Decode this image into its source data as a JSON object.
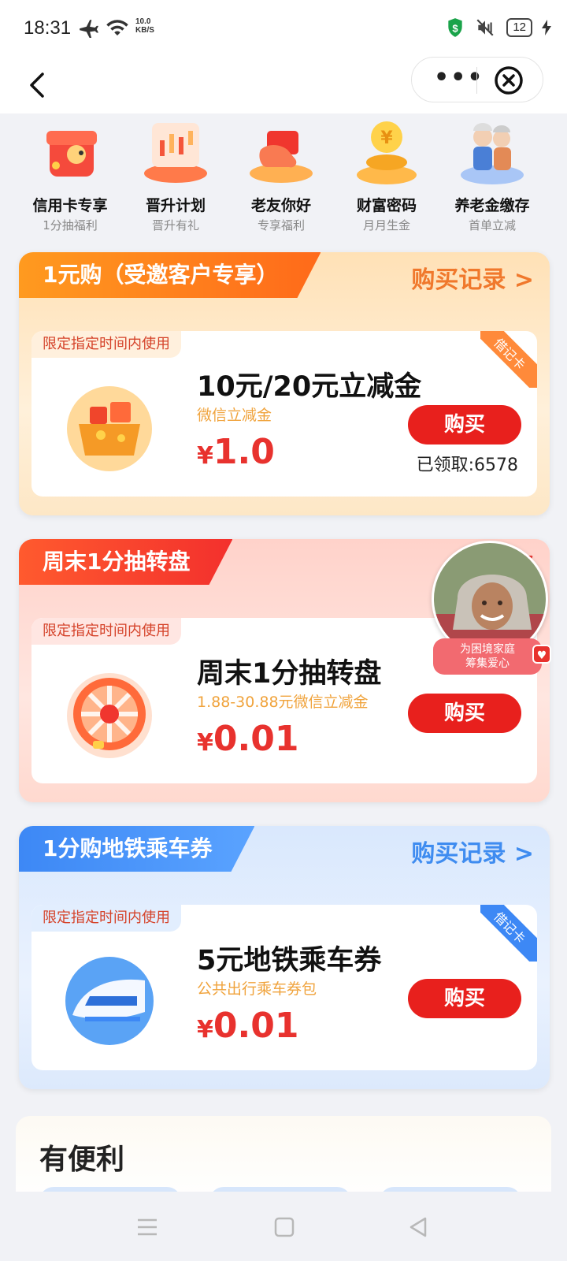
{
  "status_bar": {
    "time": "18:31",
    "net_speed_value": "10.0",
    "net_speed_unit": "KB/S",
    "battery": "12"
  },
  "nav": {
    "more_label": "•••"
  },
  "categories": [
    {
      "label": "信用卡专享",
      "sub": "1分抽福利"
    },
    {
      "label": "晋升计划",
      "sub": "晋升有礼"
    },
    {
      "label": "老友你好",
      "sub": "专享福利"
    },
    {
      "label": "财富密码",
      "sub": "月月生金"
    },
    {
      "label": "养老金缴存",
      "sub": "首单立减"
    }
  ],
  "cards": [
    {
      "tag": "1元购（受邀客户专享）",
      "link": "购买记录 >",
      "limit": "限定指定时间内使用",
      "corner": "借记卡",
      "title": "10元/20元立减金",
      "subtitle": "微信立减金",
      "price_symbol": "¥",
      "price": "1.0",
      "buy": "购买",
      "claimed": "已领取:6578"
    },
    {
      "tag": "周末1分抽转盘",
      "link": "购买",
      "limit": "限定指定时间内使用",
      "title": "周末1分抽转盘",
      "subtitle": "1.88-30.88元微信立减金",
      "price_symbol": "¥",
      "price": "0.01",
      "buy": "购买"
    },
    {
      "tag": "1分购地铁乘车券",
      "link": "购买记录 >",
      "limit": "限定指定时间内使用",
      "corner": "借记卡",
      "title": "5元地铁乘车券",
      "subtitle": "公共出行乘车券包",
      "price_symbol": "¥",
      "price": "0.01",
      "buy": "购买"
    }
  ],
  "float_ad": {
    "line1": "为困境家庭",
    "line2": "筹集爱心"
  },
  "convenience": {
    "title": "有便利"
  },
  "colors": {
    "red": "#e8201d",
    "orange_link": "#f0782c",
    "blue_link": "#3f8cf0",
    "orange_sub": "#f0a33c"
  }
}
